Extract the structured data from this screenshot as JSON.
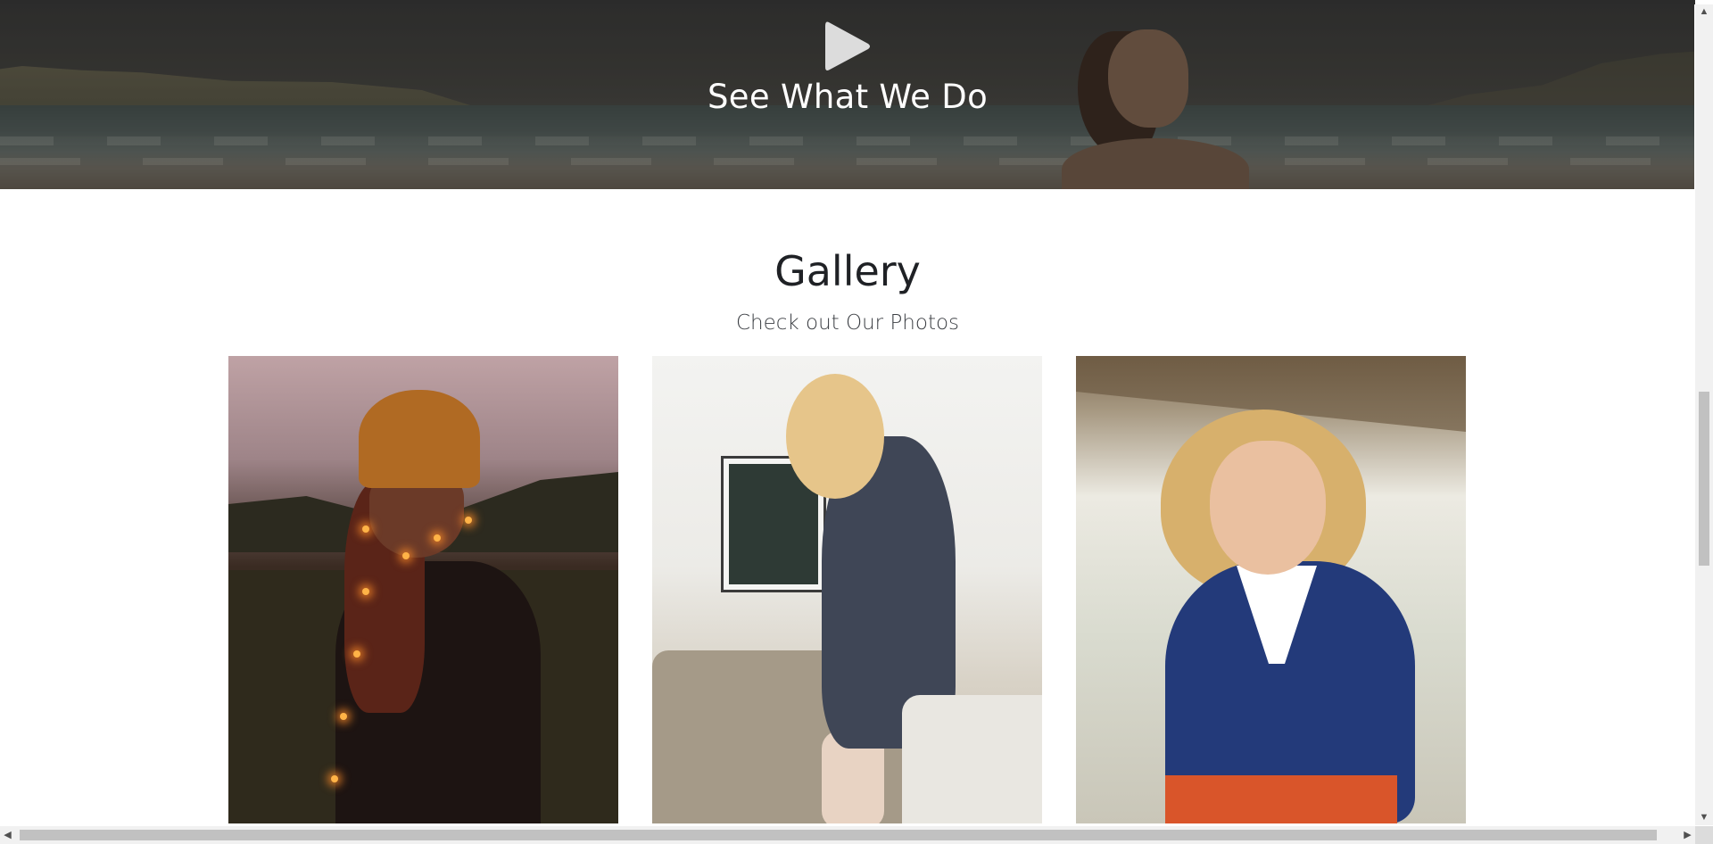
{
  "hero": {
    "title": "See What We Do",
    "play_icon": "play-icon"
  },
  "gallery": {
    "title": "Gallery",
    "subtitle": "Check out Our Photos",
    "photos": [
      {
        "description_icon": "photo-woman-beanie-string-lights"
      },
      {
        "description_icon": "photo-woman-navy-tee-sofa"
      },
      {
        "description_icon": "photo-woman-blue-polo-smiling"
      }
    ]
  },
  "scrollbars": {
    "up_arrow": "▲",
    "down_arrow": "▼",
    "left_arrow": "◀",
    "right_arrow": "▶"
  },
  "colors": {
    "hero_text": "#ffffff",
    "heading": "#1f2125",
    "subheading": "#3c3f44",
    "background": "#ffffff"
  }
}
